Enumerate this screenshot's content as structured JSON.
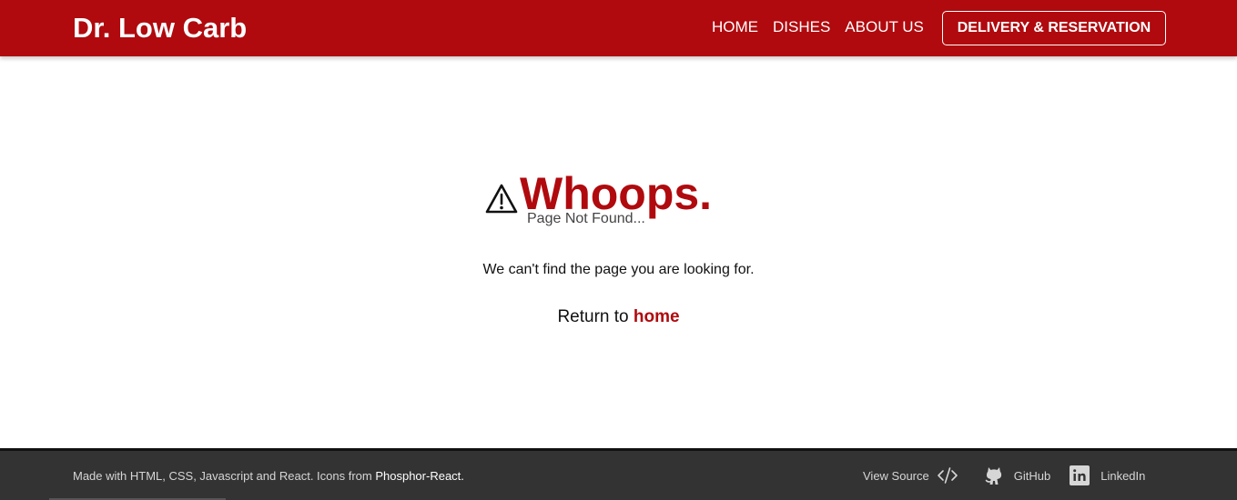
{
  "navbar": {
    "brand": "Dr. Low Carb",
    "links": [
      "HOME",
      "DISHES",
      "ABOUT US"
    ],
    "cta": "DELIVERY & RESERVATION",
    "color": "#b00a0e"
  },
  "error": {
    "icon": "warning-icon",
    "title": "Whoops.",
    "subtitle": "Page Not Found...",
    "message": "We can't find the page you are looking for.",
    "return_prefix": "Return to ",
    "return_link": "home"
  },
  "footer": {
    "made_with": "Made with HTML, CSS, Javascript and React. Icons from ",
    "icons_link": "Phosphor-React.",
    "links": [
      {
        "label": "View Source",
        "icon": "code-icon"
      },
      {
        "label": "GitHub",
        "icon": "github-octocat-icon"
      },
      {
        "label": "LinkedIn",
        "icon": "linkedin-icon"
      }
    ],
    "background": "#333333"
  }
}
